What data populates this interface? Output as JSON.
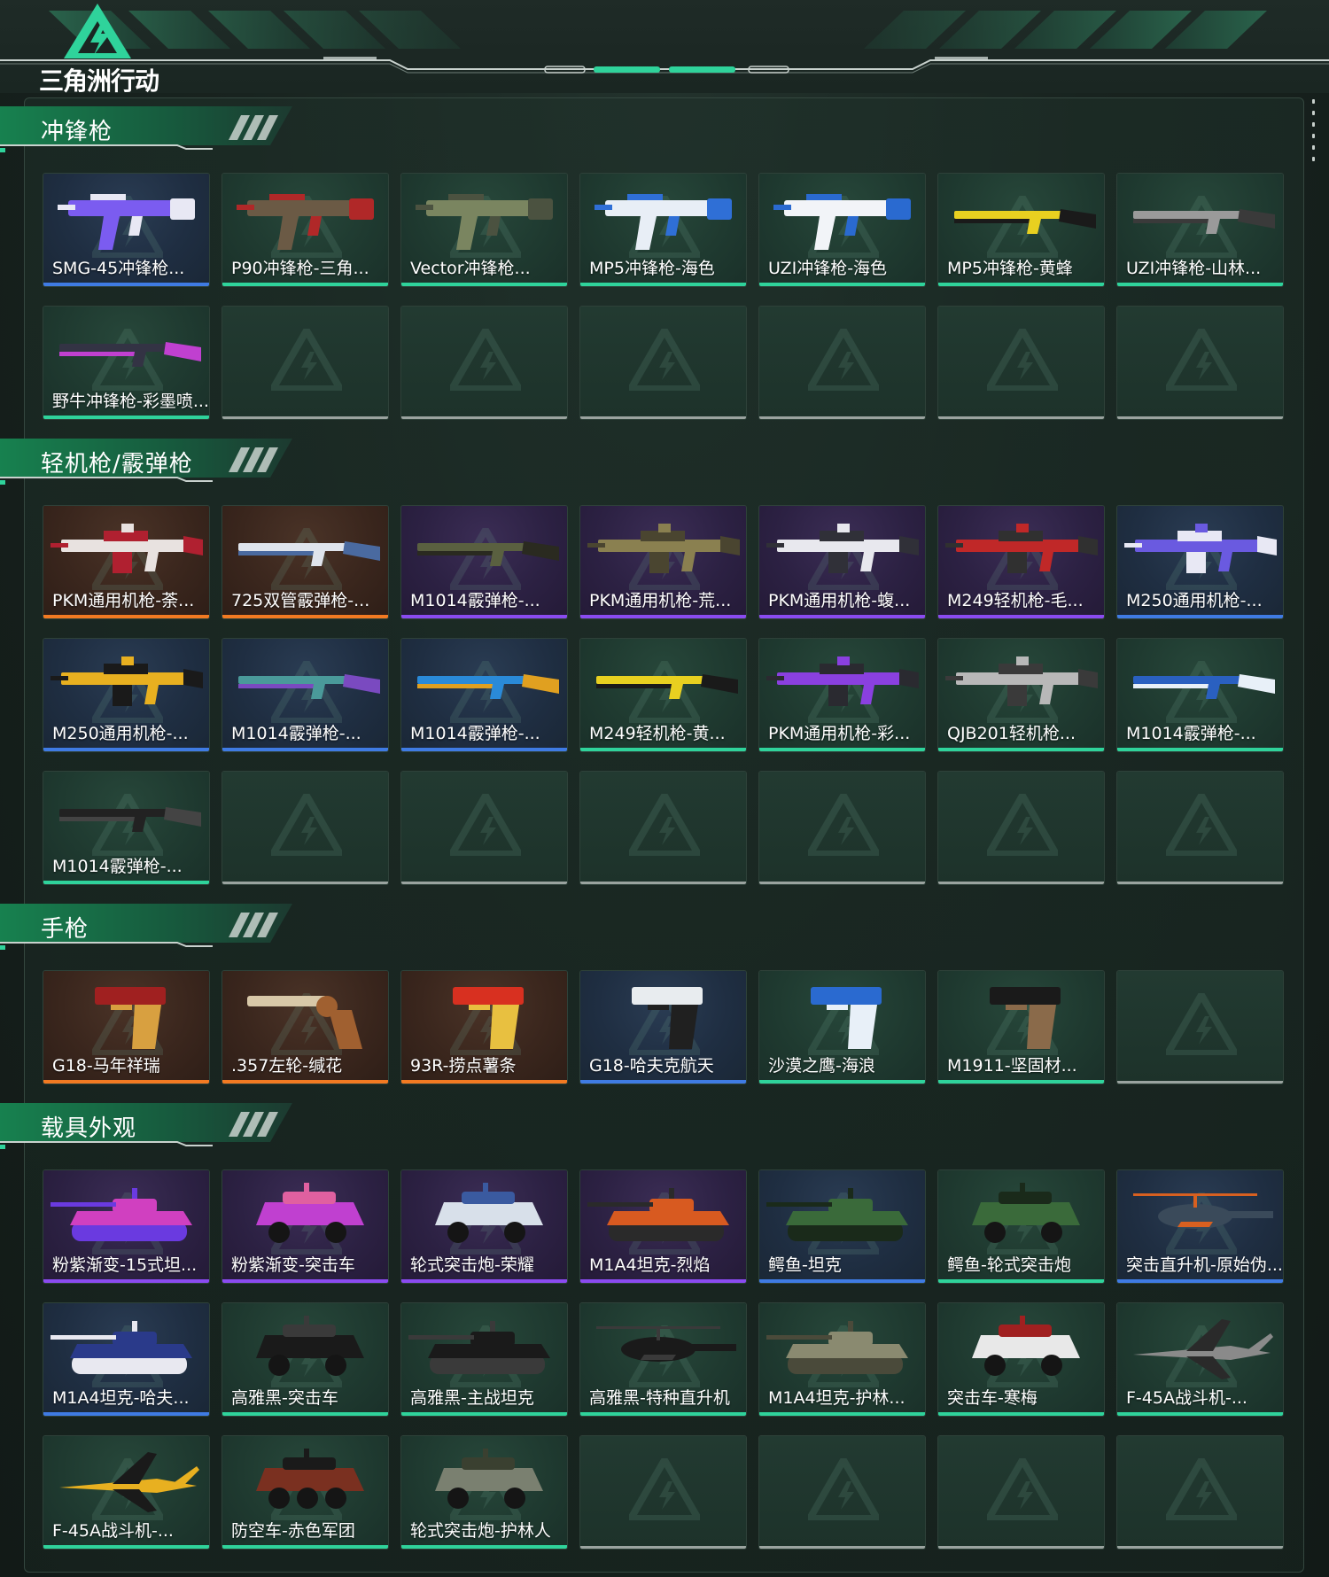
{
  "brand": {
    "name": "三角洲行动"
  },
  "sections": [
    {
      "title": "冲锋枪",
      "items": [
        {
          "label": "SMG-45冲锋枪...",
          "rarity": "blue",
          "kind": "smg",
          "c1": "#7b5cf0",
          "c2": "#e8e8f4"
        },
        {
          "label": "P90冲锋枪-三角...",
          "rarity": "green",
          "kind": "p90",
          "c1": "#6b5a45",
          "c2": "#b02828"
        },
        {
          "label": "Vector冲锋枪...",
          "rarity": "green",
          "kind": "vector",
          "c1": "#7a8560",
          "c2": "#4b5240"
        },
        {
          "label": "MP5冲锋枪-海色",
          "rarity": "green",
          "kind": "mp5",
          "c1": "#e8eef6",
          "c2": "#2f6fd6"
        },
        {
          "label": "UZI冲锋枪-海色",
          "rarity": "green",
          "kind": "uzi",
          "c1": "#f2f4f8",
          "c2": "#2a6ad0"
        },
        {
          "label": "MP5冲锋枪-黄蜂",
          "rarity": "green",
          "kind": "rifle",
          "c1": "#e8d020",
          "c2": "#1a1a1a"
        },
        {
          "label": "UZI冲锋枪-山林...",
          "rarity": "green",
          "kind": "rifle",
          "c1": "#9a9a9a",
          "c2": "#3a3a3a"
        },
        {
          "label": "野牛冲锋枪-彩墨喷...",
          "rarity": "green",
          "kind": "rifle",
          "c1": "#333344",
          "c2": "#c040d0"
        }
      ]
    },
    {
      "title": "轻机枪/霰弹枪",
      "items": [
        {
          "label": "PKM通用机枪-荼...",
          "rarity": "orange",
          "kind": "lmg",
          "c1": "#e8e2e0",
          "c2": "#b02030"
        },
        {
          "label": "725双管霰弹枪-...",
          "rarity": "orange",
          "kind": "shotgun",
          "c1": "#dfe4ec",
          "c2": "#4a6aa0"
        },
        {
          "label": "M1014霰弹枪-...",
          "rarity": "purple",
          "kind": "rifle",
          "c1": "#5a6040",
          "c2": "#2a2a20"
        },
        {
          "label": "PKM通用机枪-荒...",
          "rarity": "purple",
          "kind": "lmg",
          "c1": "#8a8050",
          "c2": "#4a4530"
        },
        {
          "label": "PKM通用机枪-蝮...",
          "rarity": "purple",
          "kind": "lmg",
          "c1": "#e8e8ee",
          "c2": "#303038"
        },
        {
          "label": "M249轻机枪-毛...",
          "rarity": "purple",
          "kind": "lmg",
          "c1": "#c02828",
          "c2": "#303030"
        },
        {
          "label": "M250通用机枪-...",
          "rarity": "blue",
          "kind": "lmg",
          "c1": "#6a5ae0",
          "c2": "#e8e8f4"
        },
        {
          "label": "M250通用机枪-...",
          "rarity": "blue",
          "kind": "lmg",
          "c1": "#e8b020",
          "c2": "#1a1a1a"
        },
        {
          "label": "M1014霰弹枪-...",
          "rarity": "blue",
          "kind": "shotgun",
          "c1": "#4a9a9a",
          "c2": "#7a4ac0"
        },
        {
          "label": "M1014霰弹枪-...",
          "rarity": "blue",
          "kind": "shotgun",
          "c1": "#2a8ad8",
          "c2": "#e0a020"
        },
        {
          "label": "M249轻机枪-黄...",
          "rarity": "green",
          "kind": "rifle",
          "c1": "#e8d020",
          "c2": "#1a1a1a"
        },
        {
          "label": "PKM通用机枪-彩...",
          "rarity": "green",
          "kind": "lmg",
          "c1": "#8a40e0",
          "c2": "#2a2a30"
        },
        {
          "label": "QJB201轻机枪...",
          "rarity": "green",
          "kind": "lmg",
          "c1": "#b8b8b8",
          "c2": "#3a3a3a"
        },
        {
          "label": "M1014霰弹枪-...",
          "rarity": "green",
          "kind": "shotgun",
          "c1": "#2a60c0",
          "c2": "#e8f0f8"
        },
        {
          "label": "M1014霰弹枪-...",
          "rarity": "green",
          "kind": "shotgun",
          "c1": "#222222",
          "c2": "#444444"
        }
      ]
    },
    {
      "title": "手枪",
      "items": [
        {
          "label": "G18-马年祥瑞",
          "rarity": "orange",
          "kind": "pistol",
          "c1": "#a02020",
          "c2": "#d8a040"
        },
        {
          "label": ".357左轮-缄花",
          "rarity": "orange",
          "kind": "revolver",
          "c1": "#d8c8a8",
          "c2": "#a06030"
        },
        {
          "label": "93R-捞点薯条",
          "rarity": "orange",
          "kind": "pistol",
          "c1": "#d83020",
          "c2": "#e8c040"
        },
        {
          "label": "G18-哈夫克航天",
          "rarity": "blue",
          "kind": "pistol",
          "c1": "#e8ecef",
          "c2": "#202020"
        },
        {
          "label": "沙漠之鹰-海浪",
          "rarity": "green",
          "kind": "pistol",
          "c1": "#2a6ad0",
          "c2": "#e8f0f8"
        },
        {
          "label": "M1911-坚固材...",
          "rarity": "green",
          "kind": "pistol",
          "c1": "#1a1a1a",
          "c2": "#8a6a4a"
        }
      ]
    },
    {
      "title": "载具外观",
      "items": [
        {
          "label": "粉紫渐变-15式坦...",
          "rarity": "purple",
          "kind": "tank",
          "c1": "#d040c0",
          "c2": "#6a3ae0"
        },
        {
          "label": "粉紫渐变-突击车",
          "rarity": "purple",
          "kind": "car",
          "c1": "#c040d0",
          "c2": "#e060a0"
        },
        {
          "label": "轮式突击炮-荣耀",
          "rarity": "purple",
          "kind": "car",
          "c1": "#d8e0ea",
          "c2": "#3a5aa0"
        },
        {
          "label": "M1A4坦克-烈焰",
          "rarity": "purple",
          "kind": "tank",
          "c1": "#d85a20",
          "c2": "#2a2a2a"
        },
        {
          "label": "鳄鱼-坦克",
          "rarity": "blue",
          "kind": "tank",
          "c1": "#3a6a3a",
          "c2": "#1a2a1a"
        },
        {
          "label": "鳄鱼-轮式突击炮",
          "rarity": "green",
          "kind": "car",
          "c1": "#3a6a3a",
          "c2": "#1a2a1a"
        },
        {
          "label": "突击直升机-原始伪...",
          "rarity": "blue",
          "kind": "heli",
          "c1": "#3a4a5a",
          "c2": "#d86020"
        },
        {
          "label": "M1A4坦克-哈夫...",
          "rarity": "blue",
          "kind": "tank",
          "c1": "#2a3a8a",
          "c2": "#e8e8f0"
        },
        {
          "label": "高雅黑-突击车",
          "rarity": "green",
          "kind": "car",
          "c1": "#1a1a1a",
          "c2": "#3a3a3a"
        },
        {
          "label": "高雅黑-主战坦克",
          "rarity": "green",
          "kind": "tank",
          "c1": "#1a1a1a",
          "c2": "#3a3a3a"
        },
        {
          "label": "高雅黑-特种直升机",
          "rarity": "green",
          "kind": "heli",
          "c1": "#1a1a1a",
          "c2": "#3a3a3a"
        },
        {
          "label": "M1A4坦克-护林...",
          "rarity": "green",
          "kind": "tank",
          "c1": "#8a8a70",
          "c2": "#4a4a3a"
        },
        {
          "label": "突击车-寒梅",
          "rarity": "green",
          "kind": "car",
          "c1": "#e8e8e8",
          "c2": "#a02020"
        },
        {
          "label": "F-45A战斗机-...",
          "rarity": "green",
          "kind": "jet",
          "c1": "#8a8a8a",
          "c2": "#2a2a2a"
        },
        {
          "label": "F-45A战斗机-...",
          "rarity": "green",
          "kind": "jet",
          "c1": "#e8b020",
          "c2": "#1a1a1a"
        },
        {
          "label": "防空车-赤色军团",
          "rarity": "green",
          "kind": "apc",
          "c1": "#7a3020",
          "c2": "#1a1a1a"
        },
        {
          "label": "轮式突击炮-护林人",
          "rarity": "green",
          "kind": "car",
          "c1": "#7a8070",
          "c2": "#3a4030"
        }
      ]
    }
  ],
  "colors": {
    "accent": "#2fd39b",
    "rarity_green": "#2fd39b",
    "rarity_blue": "#3f7be3",
    "rarity_purple": "#8a4bf0",
    "rarity_orange": "#f27a22"
  }
}
